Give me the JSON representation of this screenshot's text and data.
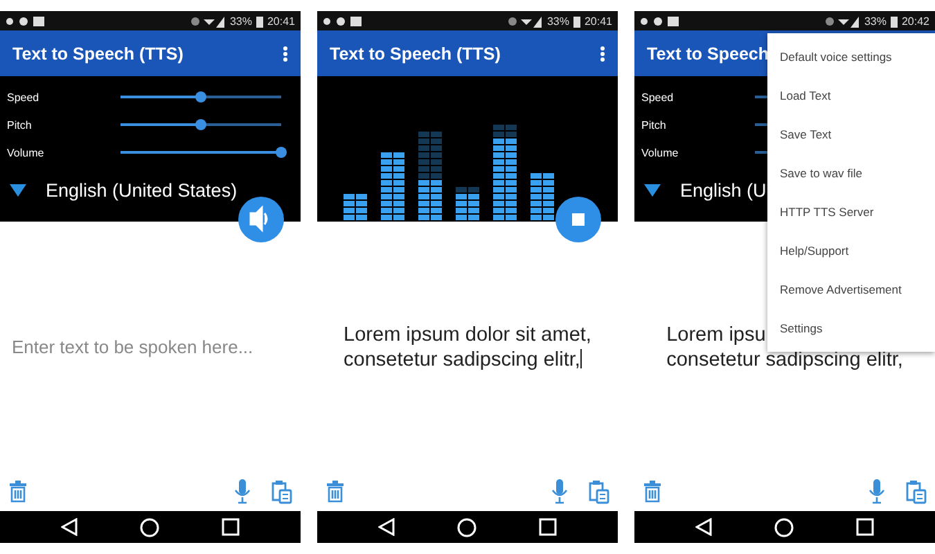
{
  "screens": [
    {
      "status": {
        "battery": "33%",
        "time": "20:41"
      },
      "title": "Text to Speech (TTS)",
      "overflow": true,
      "panel": {
        "kind": "sliders",
        "sliders": [
          {
            "label": "Speed",
            "level": 0.5
          },
          {
            "label": "Pitch",
            "level": 0.5
          },
          {
            "label": "Volume",
            "level": 1
          }
        ],
        "language": "English (United States)"
      },
      "fab": {
        "kind": "speak"
      },
      "text": {
        "placeholder": "Enter text to be spoken here..."
      }
    },
    {
      "status": {
        "battery": "33%",
        "time": "20:41"
      },
      "title": "Text to Speech (TTS)",
      "overflow": true,
      "panel": {
        "kind": "visualizer"
      },
      "fab": {
        "kind": "stop"
      },
      "text": {
        "lines": [
          "Lorem ipsum dolor sit amet,",
          "consetetur sadipscing elitr,"
        ],
        "cursor": true
      }
    },
    {
      "status": {
        "battery": "33%",
        "time": "20:42"
      },
      "title": "Text to Speech",
      "overflow": false,
      "panel": {
        "kind": "sliders",
        "sliders": [
          {
            "label": "Speed"
          },
          {
            "label": "Pitch"
          },
          {
            "label": "Volume"
          }
        ],
        "language": "English (U"
      },
      "text": {
        "lines": [
          "Lorem ipsu",
          "consetetur sadipscing elitr,"
        ],
        "cursor": false
      },
      "menu": [
        "Default voice settings",
        "Load Text",
        "Save Text",
        "Save to wav file",
        "HTTP TTS Server",
        "Help/Support",
        "Remove Advertisement",
        "Settings"
      ]
    }
  ]
}
